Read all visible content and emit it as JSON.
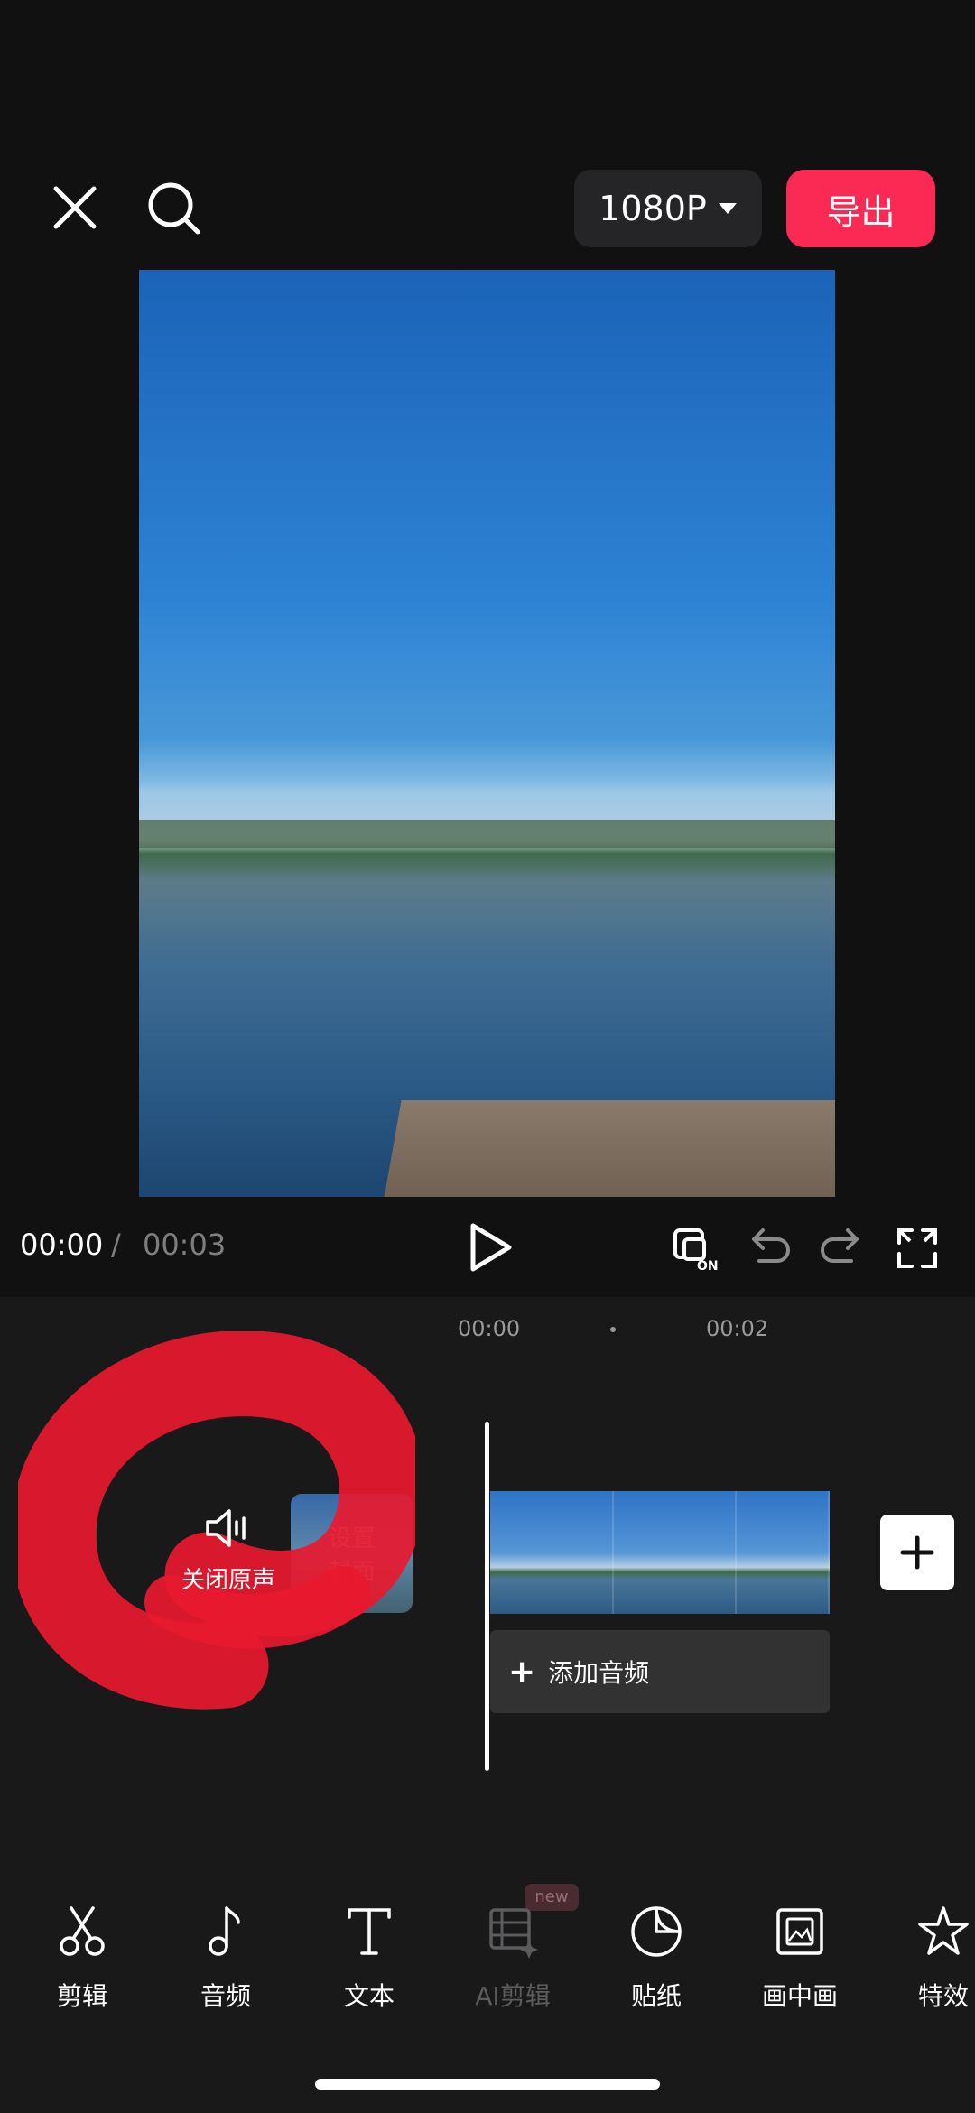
{
  "header": {
    "close_icon": "close-icon",
    "search_icon": "search-icon",
    "resolution": "1080P",
    "export_label": "导出",
    "export_color": "#fa2a55"
  },
  "player": {
    "current_time": "00:00",
    "separator": "/",
    "total_time": "00:03",
    "controls": [
      "play-icon",
      "keyframe-on-icon",
      "undo-icon",
      "redo-icon",
      "fullscreen-icon"
    ]
  },
  "timeline": {
    "tick_labels": [
      "00:00",
      "00:02"
    ],
    "mute_label": "关闭原声",
    "cover_label_line1": "设置",
    "cover_label_line2": "封面",
    "add_audio_label": "添加音频"
  },
  "toolbar": {
    "items": [
      {
        "label": "剪辑",
        "icon": "scissors-icon"
      },
      {
        "label": "音频",
        "icon": "music-note-icon"
      },
      {
        "label": "文本",
        "icon": "text-icon"
      },
      {
        "label": "AI剪辑",
        "icon": "ai-film-icon"
      },
      {
        "label": "贴纸",
        "icon": "sticker-icon"
      },
      {
        "label": "画中画",
        "icon": "picture-in-picture-icon"
      },
      {
        "label": "特效",
        "icon": "star-effect-icon"
      }
    ],
    "new_badge": "new"
  }
}
